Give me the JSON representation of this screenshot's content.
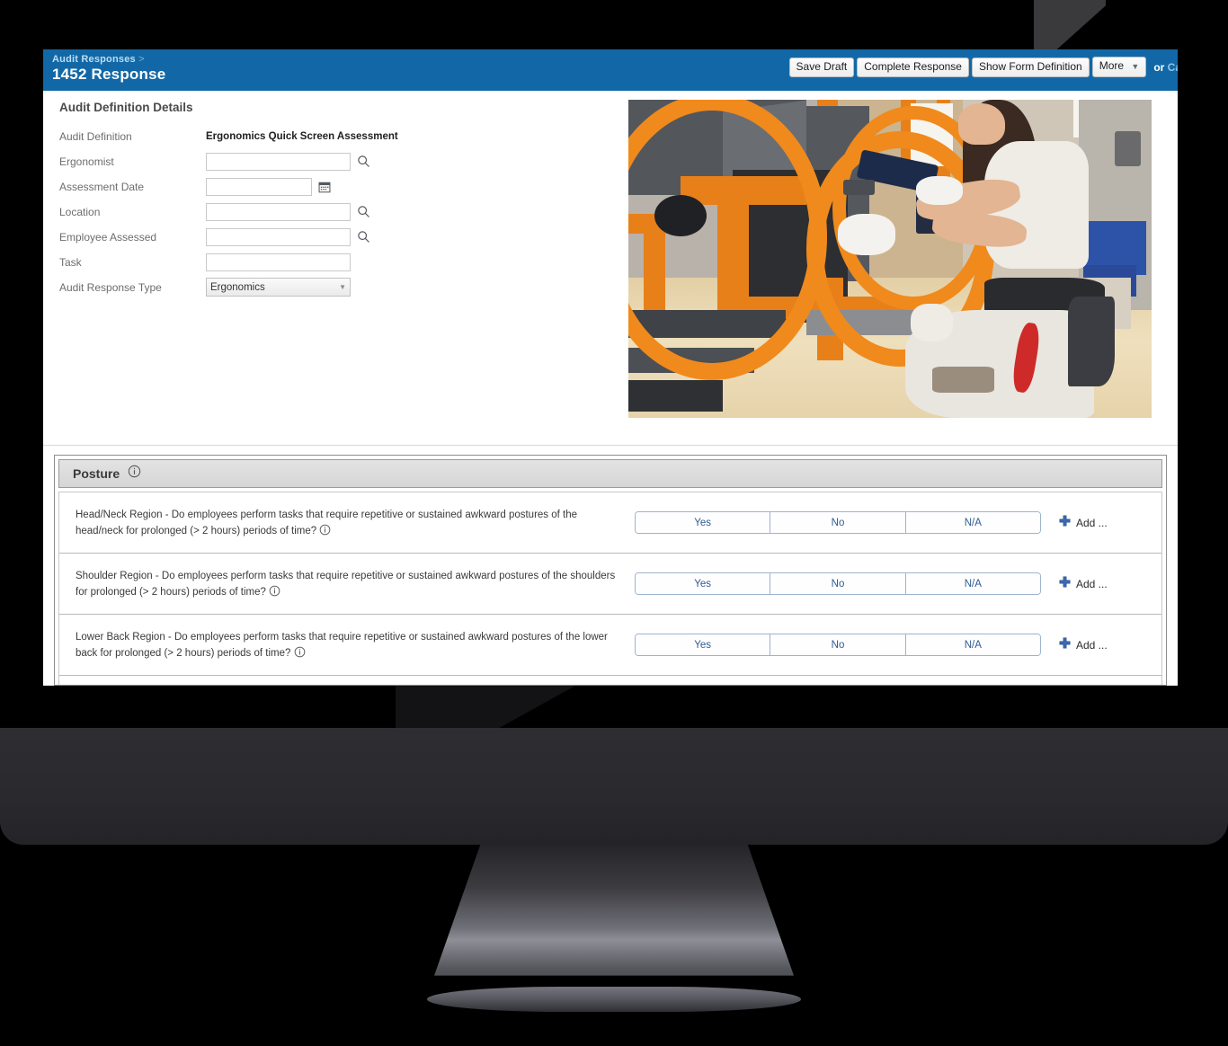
{
  "header": {
    "breadcrumb": "Audit Responses",
    "breadcrumb_separator": ">",
    "title": "1452 Response",
    "buttons": [
      {
        "label": "Save Draft",
        "name": "save-draft-button"
      },
      {
        "label": "Complete Response",
        "name": "complete-response-button"
      },
      {
        "label": "Show Form Definition",
        "name": "show-form-definition-button"
      },
      {
        "label": "More",
        "name": "more-button",
        "has_caret": true
      }
    ],
    "or_text": "or",
    "cancel_label": "Canc",
    "bar_color": "#1268a7"
  },
  "details": {
    "section_title": "Audit Definition Details",
    "fields": [
      {
        "label": "Audit Definition",
        "type": "static",
        "value": "Ergonomics Quick Screen Assessment"
      },
      {
        "label": "Ergonomist",
        "type": "lookup",
        "value": "",
        "placeholder": ""
      },
      {
        "label": "Assessment Date",
        "type": "date",
        "value": "",
        "placeholder": ""
      },
      {
        "label": "Location",
        "type": "lookup",
        "value": "",
        "placeholder": ""
      },
      {
        "label": "Employee Assessed",
        "type": "lookup",
        "value": "",
        "placeholder": ""
      },
      {
        "label": "Task",
        "type": "text",
        "value": "",
        "placeholder": ""
      },
      {
        "label": "Audit Response Type",
        "type": "select",
        "value": "Ergonomics"
      }
    ]
  },
  "photo": {
    "alt": "Factory worker kneeling at an orange assembly fixture using a power drill"
  },
  "questionnaire": {
    "section": {
      "title": "Posture",
      "info_icon": "info-icon"
    },
    "answer_options": [
      "Yes",
      "No",
      "N/A"
    ],
    "add_label": "Add ...",
    "add_icon": "plus-icon",
    "questions": [
      {
        "line1": "Head/Neck Region - Do employees perform tasks that require repetitive or sustained awkward postures of the head/neck for",
        "line2": "prolonged (> 2 hours) periods of time?"
      },
      {
        "line1": "Shoulder Region - Do employees perform tasks that require repetitive or sustained awkward postures of the shoulders for",
        "line2": "prolonged (> 2 hours) periods of time?"
      },
      {
        "line1": "Lower Back Region - Do employees perform tasks that require repetitive or sustained awkward postures of the lower back",
        "line2": "for prolonged (> 2 hours) periods of time?"
      }
    ]
  }
}
